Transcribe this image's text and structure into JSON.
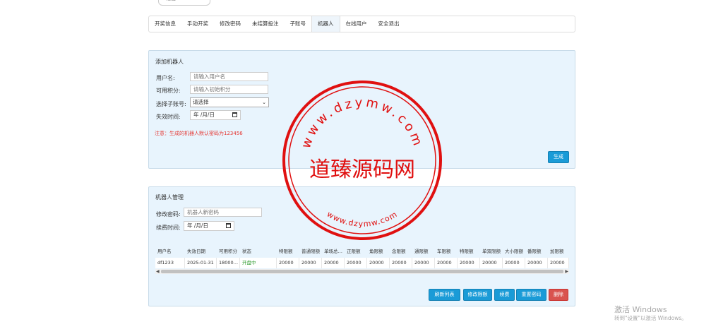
{
  "top_fragment": {
    "left_text": "退出",
    "right_text": "…"
  },
  "tabs": [
    {
      "label": "开奖信息"
    },
    {
      "label": "手动开奖"
    },
    {
      "label": "修改密码"
    },
    {
      "label": "未结算投注"
    },
    {
      "label": "子账号"
    },
    {
      "label": "机器人"
    },
    {
      "label": "在线用户"
    },
    {
      "label": "安全退出"
    }
  ],
  "active_tab": "机器人",
  "add_panel": {
    "title": "添加机器人",
    "username_label": "用户名:",
    "username_placeholder": "请输入用户名",
    "points_label": "可用积分:",
    "points_placeholder": "请输入初始积分",
    "subaccount_label": "选择子账号:",
    "subaccount_selected": "请选择",
    "expire_label": "失效时间:",
    "expire_value": "年 /月/日",
    "notice": "注意：生成的机器人默认密码为123456",
    "generate_button": "生成"
  },
  "manage_panel": {
    "title": "机器人管理",
    "password_label": "修改密码:",
    "password_placeholder": "机器人新密码",
    "renew_label": "续费时间:",
    "renew_value": "年 /月/日",
    "columns": [
      "用户名",
      "失效日期",
      "可用积分",
      "状态",
      "特限额",
      "普通限额",
      "单场总…",
      "正限额",
      "角限额",
      "念限额",
      "通限额",
      "车限额",
      "特限额",
      "单双限额",
      "大小限额",
      "番限额",
      "加限额"
    ],
    "rows": [
      {
        "cells": [
          "df1233",
          "2025-01-31",
          "18000…",
          "开盘中",
          "20000",
          "20000",
          "20000",
          "20000",
          "20000",
          "20000",
          "20000",
          "20000",
          "20000",
          "20000",
          "20000",
          "20000",
          "20000"
        ]
      }
    ],
    "status_color": "#2e9b2e",
    "buttons": {
      "refresh": "刷新列表",
      "modify_limit": "修改限额",
      "renew": "续费",
      "reset_password": "重置密码",
      "delete": "删除"
    }
  },
  "stamp": {
    "center_text": "道臻源码网",
    "top_text": "www.dzymw.com",
    "bottom_text": "www.dzymw.com",
    "color": "#e01010"
  },
  "windows_watermark": {
    "line1": "激活 Windows",
    "line2": "转到\"设置\"以激活 Windows。"
  }
}
